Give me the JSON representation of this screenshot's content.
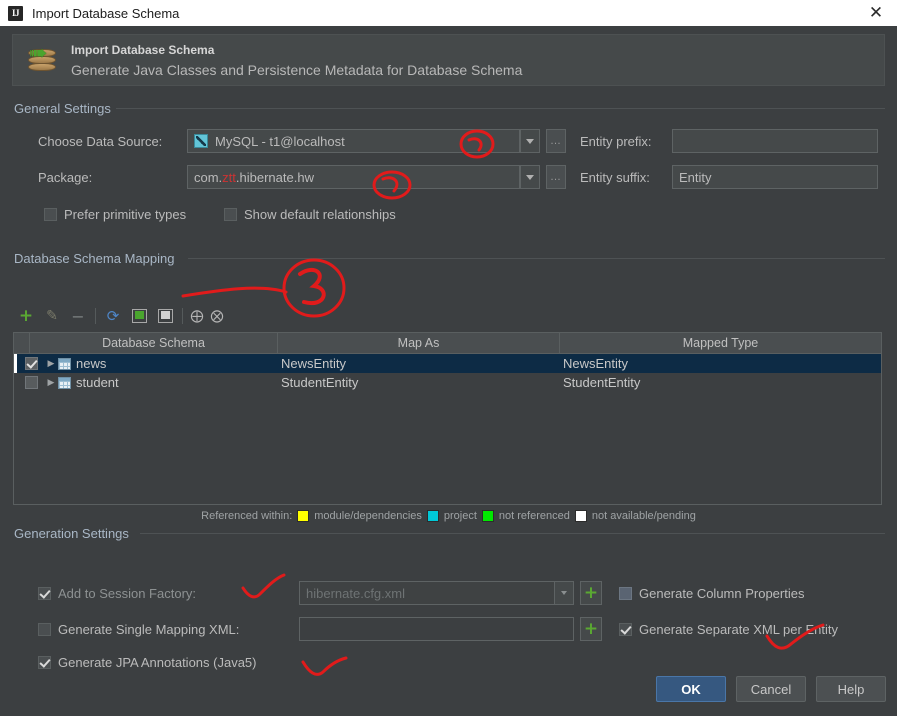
{
  "window": {
    "icon": "intellij-idea-icon",
    "icon_text": "IJ",
    "title": "Import Database Schema",
    "close_label": "✕"
  },
  "banner": {
    "icon": "database-import-icon",
    "title": "Import Database Schema",
    "subtitle": "Generate Java Classes and Persistence Metadata for Database Schema"
  },
  "general_settings": {
    "group_title": "General Settings",
    "data_source": {
      "label": "Choose Data Source:",
      "value": "MySQL - t1@localhost",
      "icon": "mysql-datasource-icon",
      "ellipsis_label": "…"
    },
    "package": {
      "label": "Package:",
      "value_prefix": "com.",
      "value_highlight": "ztt",
      "value_suffix": ".hibernate.hw",
      "ellipsis_label": "…",
      "highlight_color": "#cc3333"
    },
    "entity_prefix": {
      "label": "Entity prefix:",
      "value": ""
    },
    "entity_suffix": {
      "label": "Entity suffix:",
      "value": "Entity"
    },
    "prefer_primitive_types": {
      "label": "Prefer primitive types",
      "checked": false
    },
    "show_default_relationships": {
      "label": "Show default relationships",
      "checked": false
    }
  },
  "mapping": {
    "group_title": "Database Schema Mapping",
    "toolbar": [
      {
        "name": "add-button",
        "glyph": "+",
        "kind": "plus"
      },
      {
        "name": "edit-button",
        "glyph": "✎",
        "kind": "pencil"
      },
      {
        "name": "remove-button",
        "glyph": "−",
        "kind": "minus"
      },
      {
        "name": "refresh-button",
        "glyph": "⟳",
        "kind": "refresh"
      },
      {
        "name": "select-all-button",
        "glyph": "",
        "kind": "sq-filled"
      },
      {
        "name": "deselect-all-button",
        "glyph": "",
        "kind": "sq-empty"
      },
      {
        "name": "expand-all-button",
        "glyph": "⩛",
        "kind": "collapse"
      },
      {
        "name": "collapse-all-button",
        "glyph": "⩜",
        "kind": "collapse"
      }
    ],
    "columns": [
      "Database Schema",
      "Map As",
      "Mapped Type"
    ],
    "rows": [
      {
        "checked": true,
        "selected": true,
        "schema": "news",
        "map_as": "NewsEntity",
        "mapped_type": "NewsEntity"
      },
      {
        "checked": false,
        "selected": false,
        "schema": "student",
        "map_as": "StudentEntity",
        "mapped_type": "StudentEntity"
      }
    ],
    "legend": {
      "prefix": "Referenced within:",
      "items": [
        {
          "color": "#ffff00",
          "label": "module/dependencies"
        },
        {
          "color": "#00c8d7",
          "label": "project"
        },
        {
          "color": "#00e800",
          "label": "not referenced"
        },
        {
          "color": "#ffffff",
          "label": "not available/pending"
        }
      ]
    }
  },
  "generation_settings": {
    "group_title": "Generation Settings",
    "add_to_session_factory": {
      "label": "Add to Session Factory:",
      "mnemonic": "S",
      "checked": true,
      "disabled": true,
      "value": "hibernate.cfg.xml",
      "add_label": "+"
    },
    "generate_single_mapping_xml": {
      "label": "Generate Single Mapping XML:",
      "mnemonic": "X",
      "checked": false,
      "value": "",
      "add_label": "+"
    },
    "generate_jpa_annotations": {
      "label": "Generate JPA Annotations (Java5)",
      "mnemonic": "A",
      "checked": true
    },
    "generate_column_properties": {
      "label": "Generate Column Properties",
      "checked": false
    },
    "generate_separate_xml_per_entity": {
      "label": "Generate Separate XML per Entity",
      "checked": true
    }
  },
  "footer": {
    "ok": "OK",
    "cancel": "Cancel",
    "help": "Help"
  },
  "annotations": {
    "color": "#e11b1b",
    "marks": [
      {
        "name": "circle-datasource-annotation",
        "kind": "circle"
      },
      {
        "name": "circle-package-annotation",
        "kind": "circle"
      },
      {
        "name": "number-three-annotation",
        "kind": "digit",
        "text": "3"
      },
      {
        "name": "check-session-factory-annotation",
        "kind": "check"
      },
      {
        "name": "check-jpa-annotations-annotation",
        "kind": "check"
      },
      {
        "name": "check-separate-xml-annotation",
        "kind": "check"
      }
    ]
  }
}
